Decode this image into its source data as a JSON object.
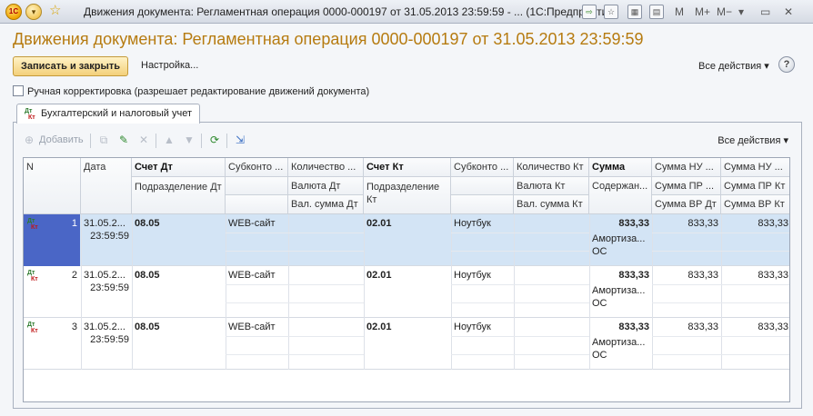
{
  "window": {
    "title": "Движения документа: Регламентная операция 0000-000197 от 31.05.2013 23:59:59 - ... (1С:Предприятие)",
    "title_controls": [
      "M",
      "M+",
      "M−"
    ],
    "logo": "1С"
  },
  "form": {
    "title": "Движения документа: Регламентная операция 0000-000197 от 31.05.2013 23:59:59",
    "save_close_label": "Записать и закрыть",
    "settings_label": "Настройка...",
    "all_actions_label": "Все действия ▾",
    "help_label": "?",
    "manual_edit_label": "Ручная корректировка (разрешает редактирование движений документа)",
    "manual_edit_checked": false
  },
  "tabs": [
    {
      "label": "Бухгалтерский и налоговый учет",
      "active": true
    }
  ],
  "dtkt": {
    "dt": "Дт",
    "kt": "Кт"
  },
  "grid_toolbar": {
    "add_label": "Добавить",
    "all_actions_label": "Все действия ▾"
  },
  "grid": {
    "headers": {
      "n": "N",
      "date": "Дата",
      "acct_dt": "Счет Дт",
      "dept_dt": "Подразделение Дт",
      "subconto_dt": "Субконто ...",
      "qty_dt": "Количество ...",
      "curr_dt": "Валюта Дт",
      "curr_sum_dt": "Вал. сумма Дт",
      "acct_kt": "Счет Кт",
      "dept_kt": "Подразделение Кт",
      "subconto_kt": "Субконто ...",
      "qty_kt": "Количество Кт",
      "curr_kt": "Валюта Кт",
      "curr_sum_kt": "Вал. сумма Кт",
      "sum": "Сумма",
      "content": "Содержан...",
      "sum_nu_dt": "Сумма НУ ...",
      "sum_pr_dt": "Сумма ПР ...",
      "sum_vr_dt": "Сумма ВР Дт",
      "sum_nu_kt": "Сумма НУ ...",
      "sum_pr_kt": "Сумма ПР Кт",
      "sum_vr_kt": "Сумма ВР Кт"
    },
    "rows": [
      {
        "n": "1",
        "date": "31.05.2...",
        "time": "23:59:59",
        "acct_dt": "08.05",
        "subconto_dt": "WEB-сайт",
        "acct_kt": "02.01",
        "subconto_kt": "Ноутбук",
        "sum": "833,33",
        "content1": "Амортиза...",
        "content2": "ОС",
        "sum_nu_dt": "833,33",
        "sum_nu_kt": "833,33",
        "selected": true
      },
      {
        "n": "2",
        "date": "31.05.2...",
        "time": "23:59:59",
        "acct_dt": "08.05",
        "subconto_dt": "WEB-сайт",
        "acct_kt": "02.01",
        "subconto_kt": "Ноутбук",
        "sum": "833,33",
        "content1": "Амортиза...",
        "content2": "ОС",
        "sum_nu_dt": "833,33",
        "sum_nu_kt": "833,33",
        "selected": false
      },
      {
        "n": "3",
        "date": "31.05.2...",
        "time": "23:59:59",
        "acct_dt": "08.05",
        "subconto_dt": "WEB-сайт",
        "acct_kt": "02.01",
        "subconto_kt": "Ноутбук",
        "sum": "833,33",
        "content1": "Амортиза...",
        "content2": "ОС",
        "sum_nu_dt": "833,33",
        "sum_nu_kt": "833,33",
        "selected": false
      }
    ]
  },
  "icons": [
    "logo-icon",
    "menu-arrow-icon",
    "star-icon",
    "back-forward-icon",
    "favorites-icon",
    "calculator-icon",
    "calendar-icon",
    "help-icon",
    "add-icon",
    "copy-icon",
    "edit-icon",
    "delete-icon",
    "move-up-icon",
    "move-down-icon",
    "refresh-icon",
    "export-icon"
  ],
  "colors": {
    "title": "#b67b10",
    "selected_row": "#d3e4f5",
    "selected_n": "#4a66c6",
    "dt": "#2d7a2d",
    "kt": "#c01818"
  }
}
